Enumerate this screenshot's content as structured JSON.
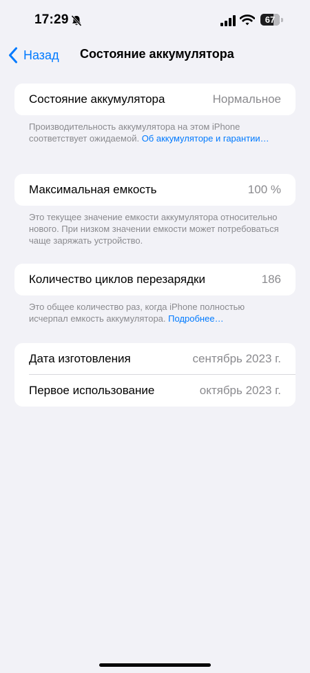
{
  "status_bar": {
    "time": "17:29",
    "battery_level": "67",
    "battery_fraction": 0.67
  },
  "nav": {
    "back_label": "Назад",
    "title": "Состояние аккумулятора"
  },
  "battery_health": {
    "label": "Состояние аккумулятора",
    "value": "Нормальное",
    "footer_text": "Производительность аккумулятора на этом iPhone соответствует ожидаемой.",
    "footer_link": "Об аккумуляторе и гарантии…"
  },
  "max_capacity": {
    "label": "Максимальная емкость",
    "value": "100 %",
    "footer_text": "Это текущее значение емкости аккумулятора относительно нового. При низком значении емкости может потребоваться чаще заряжать устройство."
  },
  "cycle_count": {
    "label": "Количество циклов перезарядки",
    "value": "186",
    "footer_text": "Это общее количество раз, когда iPhone полностью исчерпал емкость аккумулятора.",
    "footer_link": "Подробнее…"
  },
  "dates": {
    "manufacture_label": "Дата изготовления",
    "manufacture_value": "сентябрь 2023 г.",
    "first_use_label": "Первое использование",
    "first_use_value": "октябрь 2023 г."
  },
  "icons": {
    "silent": "bell-slash-icon",
    "signal": "cellular-signal-icon",
    "wifi": "wifi-icon",
    "back": "chevron-left-icon"
  },
  "colors": {
    "accent": "#007aff",
    "background": "#f2f2f7",
    "secondary_text": "#8a8a8e"
  }
}
